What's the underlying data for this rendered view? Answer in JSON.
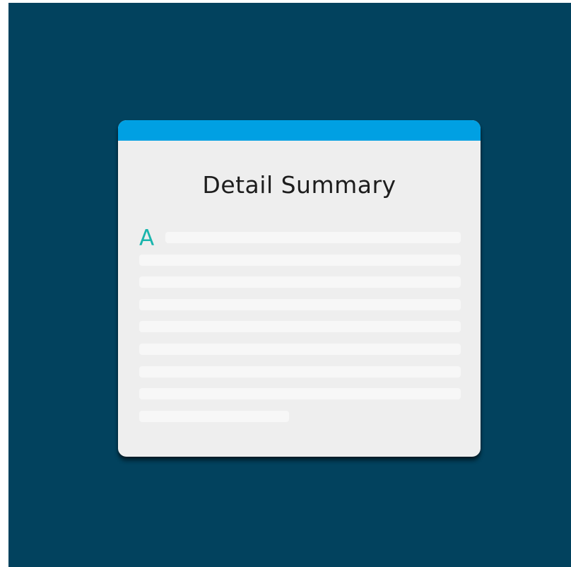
{
  "card": {
    "title": "Detail Summary",
    "drop_cap": "A",
    "header_color": "#00a0e3",
    "accent_color": "#1ab5ad"
  },
  "background_color": "#02425e"
}
